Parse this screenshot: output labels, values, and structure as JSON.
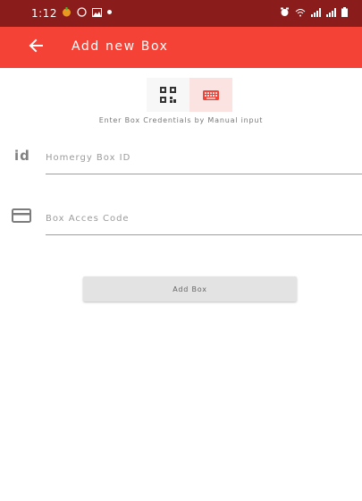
{
  "status_bar": {
    "time": "1:12",
    "left_icons": [
      "app-icon",
      "whatsapp-icon",
      "gallery-icon",
      "dot-icon"
    ],
    "right_icons": [
      "alarm-icon",
      "wifi-icon",
      "signal-icon",
      "signal-icon",
      "battery-icon"
    ]
  },
  "app_bar": {
    "title": "Add new Box",
    "back_icon": "arrow-left-icon",
    "color": "#f44336"
  },
  "input_mode": {
    "options": [
      "qr-code-icon",
      "keyboard-icon"
    ],
    "selected": "keyboard-icon",
    "instructions": "Enter Box Credentials by Manual input"
  },
  "form": {
    "id_icon_text": "id",
    "box_id_placeholder": "Homergy Box ID",
    "box_id_value": "",
    "access_code_placeholder": "Box Acces Code",
    "access_code_value": "",
    "access_code_icon": "card-icon"
  },
  "actions": {
    "add_label": "Add Box"
  }
}
